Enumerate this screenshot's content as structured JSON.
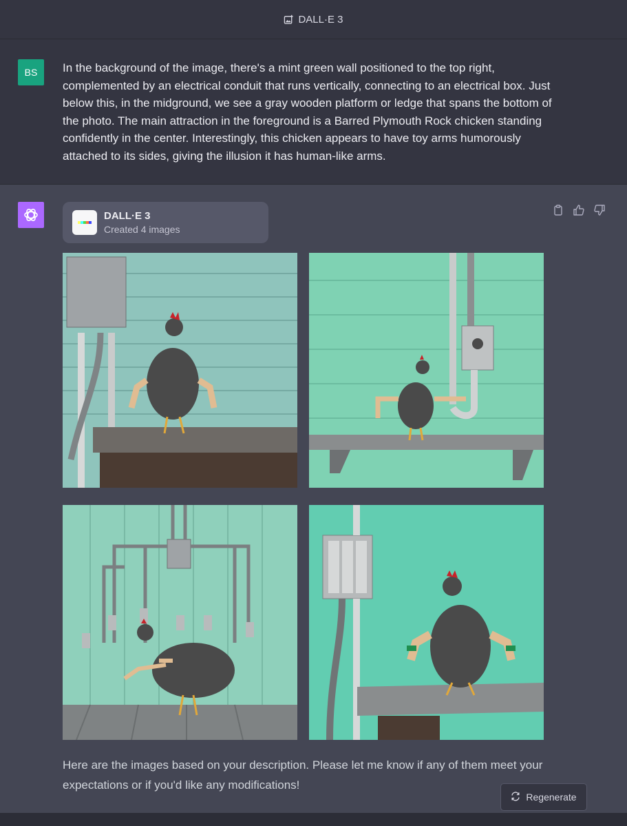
{
  "header": {
    "title": "DALL·E 3"
  },
  "user_message": {
    "avatar_initials": "BS",
    "text": "In the background of the image, there's a mint green wall positioned to the top right, complemented by an electrical conduit that runs vertically, connecting to an electrical box. Just below this, in the midground, we see a gray wooden platform or ledge that spans the bottom of the photo. The main attraction in the foreground is a Barred Plymouth Rock chicken standing confidently in the center. Interestingly, this chicken appears to have toy arms humorously attached to its sides, giving the illusion it has human-like arms."
  },
  "assistant_message": {
    "tool_card": {
      "name": "DALL·E 3",
      "status": "Created 4 images"
    },
    "images": [
      "image-1",
      "image-2",
      "image-3",
      "image-4"
    ],
    "text": "Here are the images based on your description. Please let me know if any of them meet your expectations or if you'd like any modifications!",
    "actions": [
      "clipboard-icon",
      "thumbs-up-icon",
      "thumbs-down-icon"
    ]
  },
  "regenerate": {
    "label": "Regenerate"
  },
  "colors": {
    "user_avatar": "#19a37f",
    "assistant_avatar": "#ab68ff",
    "wall": "#86d6bb",
    "panel": "#444654"
  }
}
